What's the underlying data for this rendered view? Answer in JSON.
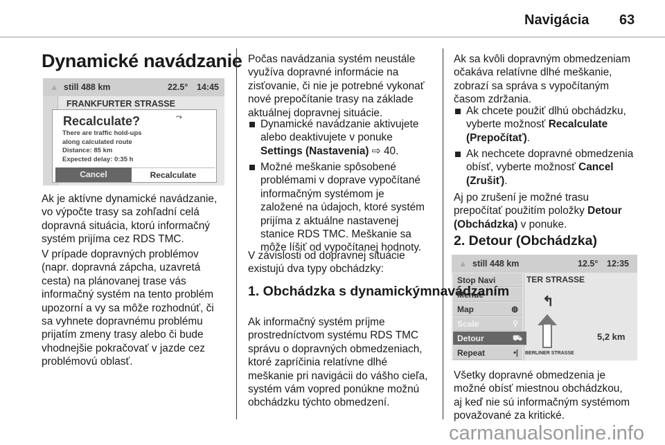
{
  "header": {
    "section": "Navigácia",
    "page_number": "63"
  },
  "title": "Dynamické navádzanie",
  "screen1": {
    "distance": "still 488 km",
    "temperature": "22.5°",
    "time": "14:45",
    "street": "FRANKFURTER STRASSE",
    "dialog": {
      "title": "Recalculate?",
      "lines": [
        "There are traffic hold-ups",
        "along calculated route",
        "Distance:  85 km",
        "Expected delay:  0:35 h"
      ],
      "cancel": "Cancel",
      "recalculate": "Recalculate"
    }
  },
  "screen2": {
    "distance": "still 448 km",
    "temperature": "12.5°",
    "time": "12:35",
    "street": "TER STRASSE",
    "menu": [
      "Stop Navi",
      "Menue",
      "Map",
      "Scale",
      "Detour",
      "Repeat"
    ],
    "selected": "Detour",
    "next_street": "BERLINER STRASSE",
    "turn_distance": "5,2 km"
  },
  "col1": [
    {
      "type": "p",
      "lines": [
        "Ak je aktívne dynamické navádzanie,",
        "vo výpočte trasy sa zohľadní celá",
        "dopravná situácia, ktorú informačný",
        "systém prijíma cez RDS TMC."
      ]
    },
    {
      "type": "p",
      "lines": [
        "V prípade dopravných problémov",
        "(napr. dopravná zápcha, uzavretá",
        "cesta) na plánovanej trase vás",
        "informačný systém na tento problém",
        "upozorní a vy sa môže rozhodnúť, či",
        "sa vyhnete dopravnému problému",
        "prijatím zmeny trasy alebo či bude",
        "vhodnejšie pokračovať v jazde cez",
        "problémovú oblasť."
      ]
    }
  ],
  "col2": [
    {
      "type": "p",
      "lines": [
        "Počas navádzania systém neustále",
        "využíva dopravné informácie na",
        "zisťovanie, či nie je potrebné vykonať",
        "nové prepočítanie trasy na základe",
        "aktuálnej dopravnej situácie."
      ]
    },
    {
      "type": "bullet",
      "lines": [
        "Dynamické navádzanie aktivujete",
        "alebo deaktivujete v ponuke",
        [
          [
            "Settings (Nastavenia)",
            true
          ],
          [
            " ⇨ 40.",
            false
          ]
        ]
      ]
    },
    {
      "type": "bullet",
      "lines": [
        "Možné meškanie spôsobené",
        "problémami v doprave vypočítané",
        "informačným systémom je",
        "založené na údajoch, ktoré systém",
        "prijíma z aktuálne nastavenej",
        "stanice RDS TMC. Meškanie sa",
        "môže líšiť od vypočítanej hodnoty."
      ]
    },
    {
      "type": "p",
      "lines": [
        "V závislosti od dopravnej situácie",
        "existujú dva typy obchádzky:"
      ]
    },
    {
      "type": "h",
      "lines": [
        "1. Obchádzka s dynamickým",
        "navádzaním"
      ]
    },
    {
      "type": "p",
      "lines": [
        "Ak informačný systém príjme",
        "prostredníctvom systému RDS TMC",
        "správu o dopravných obmedzeniach,",
        "ktoré zapríčinia relatívne dlhé",
        "meškanie pri navigácii do vášho cieľa,",
        "systém vám vopred ponúkne možnú",
        "obchádzku týchto obmedzení."
      ]
    }
  ],
  "col3": [
    {
      "type": "p",
      "lines": [
        "Ak sa kvôli dopravným obmedzeniam",
        "očakáva relatívne dlhé meškanie,",
        "zobrazí sa správa s vypočítaným",
        "časom zdržania."
      ]
    },
    {
      "type": "bullet",
      "lines": [
        "Ak chcete použiť dlhú obchádzku,",
        [
          [
            "vyberte možnosť ",
            false
          ],
          [
            "Recalculate",
            true
          ]
        ],
        [
          [
            "(Prepočítať)",
            true
          ],
          [
            ".",
            false
          ]
        ]
      ]
    },
    {
      "type": "bullet",
      "lines": [
        "Ak nechcete dopravné obmedzenia",
        [
          [
            "obísť, vyberte možnosť ",
            false
          ],
          [
            "Cancel",
            true
          ]
        ],
        [
          [
            "(Zrušiť)",
            true
          ],
          [
            ".",
            false
          ]
        ]
      ]
    },
    {
      "type": "p",
      "lines": [
        "Aj po zrušení je možné trasu",
        [
          [
            "prepočítať použitím položky ",
            false
          ],
          [
            "Detour",
            true
          ]
        ],
        [
          [
            "(Obchádzka)",
            true
          ],
          [
            " v ponuke.",
            false
          ]
        ]
      ]
    },
    {
      "type": "h",
      "lines": [
        "2. Detour (Obchádzka)"
      ]
    },
    {
      "type": "p",
      "lines": [
        "Všetky dopravné obmedzenia je",
        "možné obísť miestnou obchádzkou,",
        "aj keď nie sú informačným systémom",
        "považované za kritické."
      ]
    }
  ],
  "watermark": "carmanualsonline.info",
  "colors": {
    "text": "#1a1a1a",
    "screen_bg": "#e6e6e6",
    "selected_item": "#666666"
  }
}
